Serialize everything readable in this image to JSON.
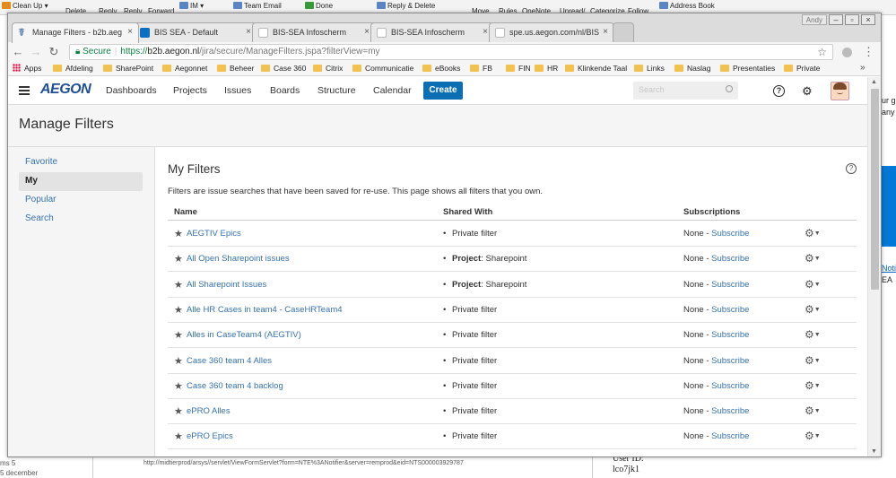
{
  "outlook": {
    "ribbon": [
      "Clean Up",
      "Delete",
      "Reply",
      "Reply",
      "Forward",
      "IM",
      "Team Email",
      "Done",
      "Reply & Delete",
      "Move",
      "Rules",
      "OneNote",
      "Unread/",
      "Categorize",
      "Follow",
      "Address Book"
    ],
    "right_texts": [
      "ur g",
      "any",
      "Noti",
      "EA"
    ],
    "bottom": {
      "left1": "ms 5",
      "left2": "5 december",
      "url": "http://midtierprod/arsys//servlet/ViewFormServlet?form=NTE%3ANotifier&server=remprod&eid=NTS000003929787",
      "right1": "User ID:",
      "right2": "lco7jk1"
    }
  },
  "browser": {
    "user_label": "Andy",
    "tabs": [
      {
        "title": "Manage Filters - b2b.aeg",
        "favicon_color": "#1f4e96",
        "active": true
      },
      {
        "title": "BIS SEA - Default",
        "favicon_color": "#0b6fc4",
        "active": false
      },
      {
        "title": "BIS-SEA Infoscherm",
        "favicon_color": "#cccccc",
        "active": false
      },
      {
        "title": "BIS-SEA Infoscherm",
        "favicon_color": "#cccccc",
        "active": false
      },
      {
        "title": "spe.us.aegon.com/nl/BIS",
        "favicon_color": "#cccccc",
        "active": false
      }
    ],
    "address": {
      "secure_label": "Secure",
      "scheme": "https://",
      "host": "b2b.aegon.nl",
      "path": "/jira/secure/ManageFilters.jspa?filterView=my"
    },
    "bookmarks": [
      "Apps",
      "Afdeling",
      "SharePoint",
      "Aegonnet",
      "Beheer",
      "Case 360",
      "Citrix",
      "Communicatie",
      "eBooks",
      "FB",
      "FIN",
      "HR",
      "Klinkende Taal",
      "Links",
      "Naslag",
      "Presentaties",
      "Private"
    ]
  },
  "jira": {
    "logo": "AEGON",
    "nav": [
      "Dashboards",
      "Projects",
      "Issues",
      "Boards",
      "Structure",
      "Calendar"
    ],
    "create_label": "Create",
    "search_placeholder": "Search",
    "help_label": "?",
    "page_title": "Manage Filters",
    "sidebar": [
      {
        "label": "Favorite",
        "selected": false
      },
      {
        "label": "My",
        "selected": true
      },
      {
        "label": "Popular",
        "selected": false
      },
      {
        "label": "Search",
        "selected": false
      }
    ],
    "section_title": "My Filters",
    "description": "Filters are issue searches that have been saved for re-use. This page shows all filters that you own.",
    "columns": {
      "name": "Name",
      "shared": "Shared With",
      "subs": "Subscriptions"
    },
    "filters": [
      {
        "name": "AEGTIV Epics",
        "shared_prefix": "",
        "shared": "Private filter",
        "subs_prefix": "None - ",
        "subs_link": "Subscribe"
      },
      {
        "name": "All Open Sharepoint issues",
        "shared_prefix": "Project",
        "shared": ": Sharepoint",
        "subs_prefix": "None - ",
        "subs_link": "Subscribe"
      },
      {
        "name": "All Sharepoint Issues",
        "shared_prefix": "Project",
        "shared": ": Sharepoint",
        "subs_prefix": "None - ",
        "subs_link": "Subscribe"
      },
      {
        "name": "Alle HR Cases in team4 - CaseHRTeam4",
        "shared_prefix": "",
        "shared": "Private filter",
        "subs_prefix": "None - ",
        "subs_link": "Subscribe"
      },
      {
        "name": "Alles in CaseTeam4 (AEGTIV)",
        "shared_prefix": "",
        "shared": "Private filter",
        "subs_prefix": "None - ",
        "subs_link": "Subscribe"
      },
      {
        "name": "Case 360 team 4 Alles",
        "shared_prefix": "",
        "shared": "Private filter",
        "subs_prefix": "None - ",
        "subs_link": "Subscribe"
      },
      {
        "name": "Case 360 team 4 backlog",
        "shared_prefix": "",
        "shared": "Private filter",
        "subs_prefix": "None - ",
        "subs_link": "Subscribe"
      },
      {
        "name": "ePRO Alles",
        "shared_prefix": "",
        "shared": "Private filter",
        "subs_prefix": "None - ",
        "subs_link": "Subscribe"
      },
      {
        "name": "ePRO Epics",
        "shared_prefix": "",
        "shared": "Private filter",
        "subs_prefix": "None - ",
        "subs_link": "Subscribe"
      }
    ]
  }
}
